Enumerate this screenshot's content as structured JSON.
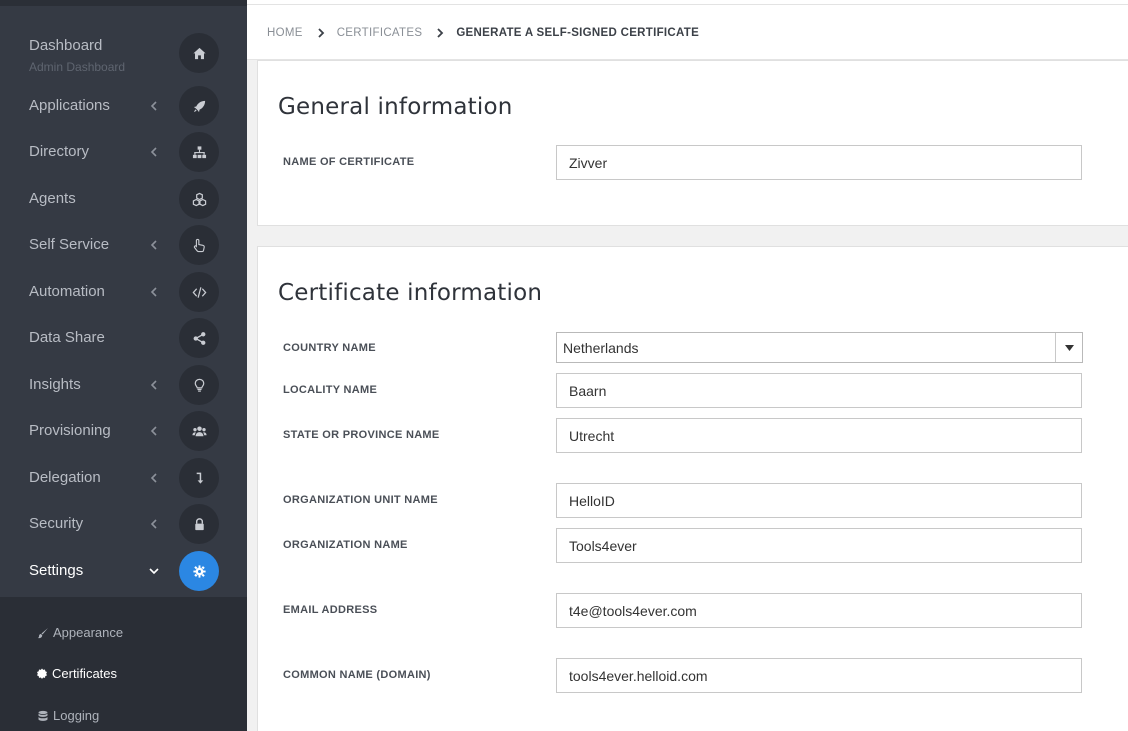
{
  "sidebar": {
    "items": [
      {
        "label": "Dashboard",
        "sub": "Admin Dashboard",
        "icon": "home-icon",
        "has_chevron": false
      },
      {
        "label": "Applications",
        "icon": "rocket-icon",
        "has_chevron": true
      },
      {
        "label": "Directory",
        "icon": "sitemap-icon",
        "has_chevron": true
      },
      {
        "label": "Agents",
        "icon": "cubes-icon",
        "has_chevron": false
      },
      {
        "label": "Self Service",
        "icon": "hand-pointer-icon",
        "has_chevron": true
      },
      {
        "label": "Automation",
        "icon": "code-icon",
        "has_chevron": true
      },
      {
        "label": "Data Share",
        "icon": "share-icon",
        "has_chevron": false
      },
      {
        "label": "Insights",
        "icon": "lightbulb-icon",
        "has_chevron": true
      },
      {
        "label": "Provisioning",
        "icon": "users-icon",
        "has_chevron": true
      },
      {
        "label": "Delegation",
        "icon": "level-down-icon",
        "has_chevron": true
      },
      {
        "label": "Security",
        "icon": "lock-icon",
        "has_chevron": true
      },
      {
        "label": "Settings",
        "icon": "gear-icon",
        "has_chevron": true,
        "active": true
      }
    ],
    "subitems": [
      {
        "label": "Appearance",
        "icon": "paintbrush-icon"
      },
      {
        "label": "Certificates",
        "icon": "certificate-icon",
        "active": true
      },
      {
        "label": "Logging",
        "icon": "database-icon"
      }
    ]
  },
  "breadcrumb": {
    "home": "HOME",
    "certificates": "CERTIFICATES",
    "current": "GENERATE A SELF-SIGNED CERTIFICATE"
  },
  "general": {
    "title": "General information",
    "name_label": "NAME OF CERTIFICATE",
    "name_value": "Zivver"
  },
  "certificate": {
    "title": "Certificate information",
    "country_label": "COUNTRY NAME",
    "country_value": "Netherlands",
    "locality_label": "LOCALITY NAME",
    "locality_value": "Baarn",
    "state_label": "STATE OR PROVINCE NAME",
    "state_value": "Utrecht",
    "org_unit_label": "ORGANIZATION UNIT NAME",
    "org_unit_value": "HelloID",
    "org_label": "ORGANIZATION NAME",
    "org_value": "Tools4ever",
    "email_label": "EMAIL ADDRESS",
    "email_value": "t4e@tools4ever.com",
    "common_label": "COMMON NAME (DOMAIN)",
    "common_value": "tools4ever.helloid.com"
  },
  "colors": {
    "sidebar_bg": "#353a44",
    "accent": "#2b87e3"
  }
}
